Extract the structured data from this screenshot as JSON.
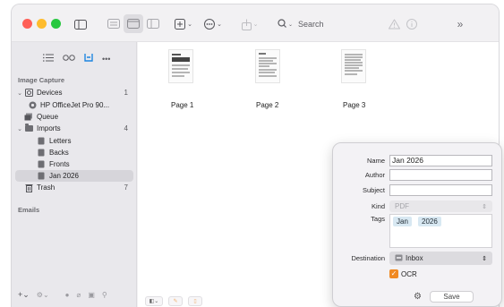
{
  "toolbar": {
    "search_placeholder": "Search",
    "traffic_lights": [
      "#ff5f57",
      "#febc2e",
      "#28c840"
    ]
  },
  "sidebar": {
    "section_image_capture": "Image Capture",
    "devices": {
      "label": "Devices",
      "count": "1"
    },
    "device_item": "HP OfficeJet Pro 90...",
    "queue": "Queue",
    "imports": {
      "label": "Imports",
      "count": "4"
    },
    "import_items": [
      "Letters",
      "Backs",
      "Fronts",
      "Jan 2026"
    ],
    "trash": {
      "label": "Trash",
      "count": "7"
    },
    "section_emails": "Emails",
    "selected_color": "#d6d5da"
  },
  "pages": [
    {
      "label": "Page 1"
    },
    {
      "label": "Page 2"
    },
    {
      "label": "Page 3"
    }
  ],
  "panel": {
    "name_label": "Name",
    "name_value": "Jan 2026",
    "author_label": "Author",
    "author_value": "",
    "subject_label": "Subject",
    "subject_value": "",
    "kind_label": "Kind",
    "kind_value": "PDF",
    "tags_label": "Tags",
    "tags": [
      "Jan",
      "2026"
    ],
    "destination_label": "Destination",
    "destination_value": "Inbox",
    "ocr_label": "OCR",
    "ocr_checked": true,
    "ocr_color": "#f08a24",
    "save_label": "Save"
  }
}
